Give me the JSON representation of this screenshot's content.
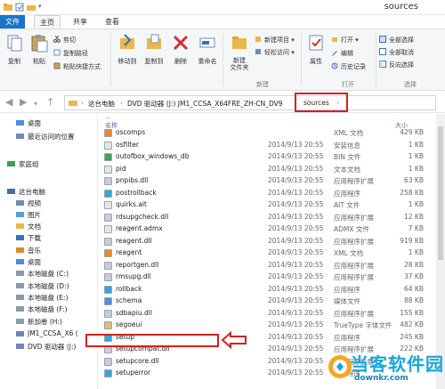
{
  "window": {
    "title": "sources"
  },
  "tabs": [
    "文件",
    "主页",
    "共享",
    "查看"
  ],
  "ribbon": {
    "copy": "复制",
    "paste": "粘贴",
    "cut": "剪切",
    "copy_path": "复制路径",
    "paste_shortcut": "粘贴快捷方式",
    "move_to": "移动到",
    "copy_to": "复制到",
    "delete": "删除",
    "rename": "重命名",
    "new_folder": "新建\n文件夹",
    "new_item": "新建项目",
    "easy_access": "轻松访问",
    "properties": "属性",
    "open": "打开",
    "edit": "编辑",
    "history": "历史记录",
    "select_all": "全部选择",
    "select_none": "全部取消",
    "invert_selection": "反向选择",
    "group_new": "新建",
    "group_open": "打开",
    "group_select": "选择"
  },
  "address": {
    "crumbs": [
      "这台电脑",
      "DVD 驱动器 (J:) JM1_CCSA_X64FRE_ZH-CN_DV9",
      "sources"
    ]
  },
  "sidebar": {
    "items": [
      {
        "label": "桌面",
        "icon": "desktop-icon"
      },
      {
        "label": "最近访问的位置",
        "icon": "recent-icon"
      },
      {
        "label": "家庭组",
        "icon": "homegroup-icon"
      },
      {
        "label": "这台电脑",
        "icon": "computer-icon"
      },
      {
        "label": "视频",
        "icon": "videos-icon"
      },
      {
        "label": "图片",
        "icon": "pictures-icon"
      },
      {
        "label": "文档",
        "icon": "documents-icon"
      },
      {
        "label": "下载",
        "icon": "downloads-icon"
      },
      {
        "label": "音乐",
        "icon": "music-icon"
      },
      {
        "label": "桌面",
        "icon": "desktop-icon"
      },
      {
        "label": "本地磁盘 (C:)",
        "icon": "drive-icon"
      },
      {
        "label": "本地磁盘 (D:)",
        "icon": "drive-icon"
      },
      {
        "label": "本地磁盘 (E:)",
        "icon": "drive-icon"
      },
      {
        "label": "本地磁盘 (F:)",
        "icon": "drive-icon"
      },
      {
        "label": "新加卷 (H:)",
        "icon": "drive-icon"
      },
      {
        "label": "JM1_CCSA_X6 (",
        "icon": "dvd-icon"
      },
      {
        "label": "DVD 驱动器 (J:)",
        "icon": "dvd-icon"
      }
    ]
  },
  "columns": {
    "name": "名称",
    "size": "大小"
  },
  "files": [
    {
      "name": "oscomps",
      "date": "",
      "type": "XML 文档",
      "size": "429 KB"
    },
    {
      "name": "osfilter",
      "date": "2014/9/13 20:55",
      "type": "安装信息",
      "size": "1 KB"
    },
    {
      "name": "outofbox_windows_db",
      "date": "2014/9/13 20:55",
      "type": "BIN 文件",
      "size": "1 KB"
    },
    {
      "name": "pid",
      "date": "2014/9/13 20:55",
      "type": "文本文档",
      "size": "1 KB"
    },
    {
      "name": "pnpibs.dll",
      "date": "2014/9/13 20:55",
      "type": "应用程序扩展",
      "size": "63 KB"
    },
    {
      "name": "postrollback",
      "date": "2014/9/13 20:55",
      "type": "应用程序",
      "size": "258 KB"
    },
    {
      "name": "quirks.ait",
      "date": "2014/9/13 20:55",
      "type": "AIT 文件",
      "size": "1 KB"
    },
    {
      "name": "rdsupgcheck.dll",
      "date": "2014/9/13 20:55",
      "type": "应用程序扩展",
      "size": "12 KB"
    },
    {
      "name": "reagent.admx",
      "date": "2014/9/13 20:55",
      "type": "ADMX 文件",
      "size": "7 KB"
    },
    {
      "name": "reagent.dll",
      "date": "2014/9/13 20:55",
      "type": "应用程序扩展",
      "size": "919 KB"
    },
    {
      "name": "reagent",
      "date": "2014/9/13 20:55",
      "type": "XML 文档",
      "size": "1 KB"
    },
    {
      "name": "reportgen.dll",
      "date": "2014/9/13 20:55",
      "type": "应用程序扩展",
      "size": "28 KB"
    },
    {
      "name": "rmsupg.dll",
      "date": "2014/9/13 20:55",
      "type": "应用程序扩展",
      "size": "37 KB"
    },
    {
      "name": "rollback",
      "date": "2014/9/13 20:55",
      "type": "应用程序",
      "size": "64 KB"
    },
    {
      "name": "schema",
      "date": "2014/9/13 20:55",
      "type": "媒体文件",
      "size": "88 KB"
    },
    {
      "name": "sdbapiu.dll",
      "date": "2014/9/13 20:55",
      "type": "应用程序扩展",
      "size": "155 KB"
    },
    {
      "name": "segoeui",
      "date": "2014/9/13 20:55",
      "type": "TrueType 字体文件",
      "size": "482 KB"
    },
    {
      "name": "setup",
      "date": "2014/9/13 20:55",
      "type": "应用程序",
      "size": "245 KB"
    },
    {
      "name": "setupcompat.dll",
      "date": "2014/9/13 20:55",
      "type": "应用程序扩展",
      "size": "222 KB"
    },
    {
      "name": "setupcore.dll",
      "date": "2014/9/13 20:55",
      "type": "应用程序扩展",
      "size": ""
    },
    {
      "name": "setuperror",
      "date": "2014/9/13 20:55",
      "type": "应用程序",
      "size": ""
    }
  ],
  "watermark": {
    "text": "当客软件园",
    "url": "downkr.com"
  },
  "colors": {
    "accent": "#1a73c9",
    "highlight": "#d42020"
  }
}
